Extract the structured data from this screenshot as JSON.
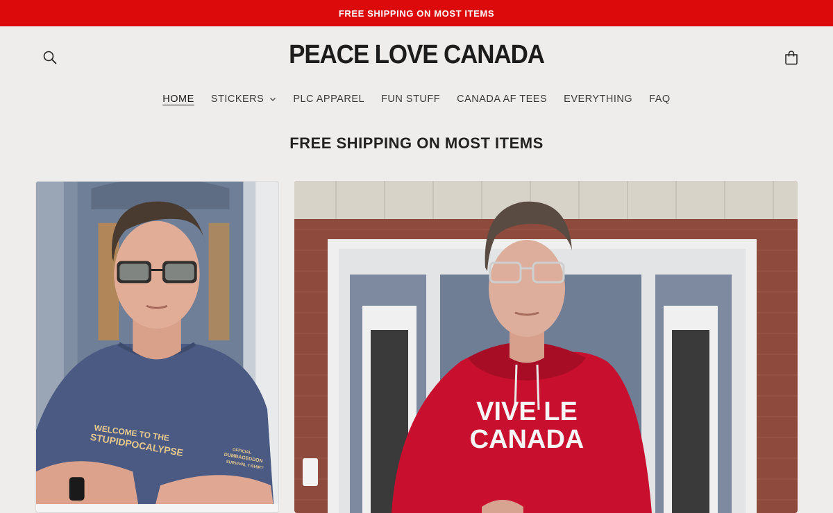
{
  "announcement": {
    "text": "FREE SHIPPING ON MOST ITEMS"
  },
  "header": {
    "logo": "PEACE LOVE CANADA",
    "search_icon": "search-icon",
    "cart_icon": "cart-icon"
  },
  "nav": {
    "items": [
      {
        "label": "HOME",
        "active": true
      },
      {
        "label": "STICKERS",
        "has_dropdown": true
      },
      {
        "label": "PLC APPAREL"
      },
      {
        "label": "FUN STUFF"
      },
      {
        "label": "CANADA AF TEES"
      },
      {
        "label": "EVERYTHING"
      },
      {
        "label": "FAQ"
      }
    ]
  },
  "main": {
    "section_title": "FREE SHIPPING ON MOST ITEMS",
    "cards": [
      {
        "shirt_text_line1": "WELCOME TO THE",
        "shirt_text_line2": "STUPIDPOCALYPSE",
        "sleeve_text_line1": "OFFICIAL",
        "sleeve_text_line2": "DUMBAGEDDON",
        "sleeve_text_line3": "SURVIVAL T-SHIRT"
      },
      {
        "hoodie_text_line1": "VIVE LE",
        "hoodie_text_line2": "CANADA"
      }
    ]
  },
  "colors": {
    "announcement_bg": "#dc0a0a",
    "page_bg": "#efedeb",
    "hoodie_red": "#c8102e",
    "tshirt_blue": "#4a5a82"
  }
}
